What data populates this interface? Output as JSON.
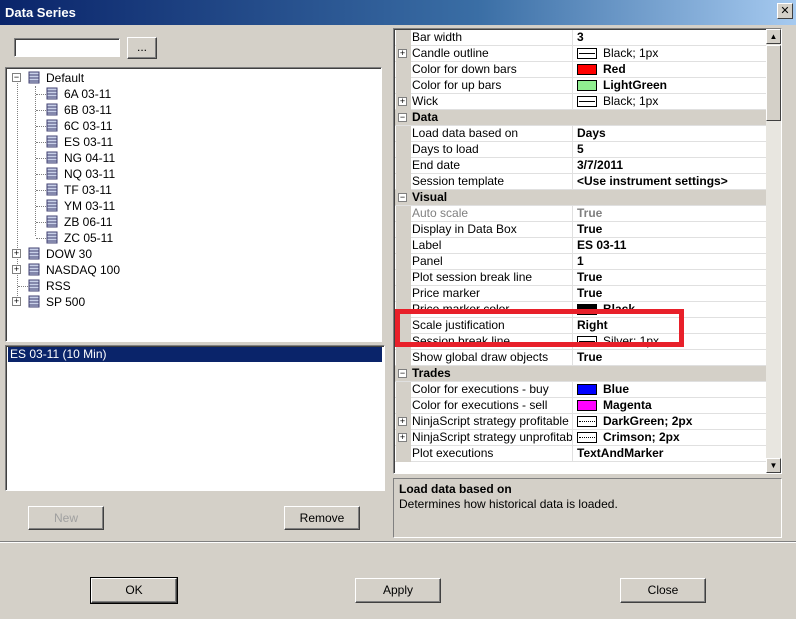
{
  "window": {
    "title": "Data Series",
    "close_glyph": "✕"
  },
  "search": {
    "value": "",
    "button_label": "..."
  },
  "tree": {
    "items": [
      {
        "label": "Default",
        "level": 0,
        "expander": "−"
      },
      {
        "label": "6A 03-11",
        "level": 1
      },
      {
        "label": "6B 03-11",
        "level": 1
      },
      {
        "label": "6C 03-11",
        "level": 1
      },
      {
        "label": "ES 03-11",
        "level": 1
      },
      {
        "label": "NG 04-11",
        "level": 1
      },
      {
        "label": "NQ 03-11",
        "level": 1
      },
      {
        "label": "TF 03-11",
        "level": 1
      },
      {
        "label": "YM 03-11",
        "level": 1
      },
      {
        "label": "ZB 06-11",
        "level": 1
      },
      {
        "label": "ZC 05-11",
        "level": 1
      },
      {
        "label": "DOW 30",
        "level": 0,
        "expander": "+"
      },
      {
        "label": "NASDAQ 100",
        "level": 0,
        "expander": "+"
      },
      {
        "label": "RSS",
        "level": 0
      },
      {
        "label": "SP 500",
        "level": 0,
        "expander": "+"
      }
    ]
  },
  "series_list": {
    "selected": "ES 03-11 (10 Min)"
  },
  "buttons": {
    "new": "New",
    "remove": "Remove",
    "ok": "OK",
    "apply": "Apply",
    "close": "Close"
  },
  "properties": {
    "rows": [
      {
        "name": "Bar width",
        "value": "3"
      },
      {
        "name": "Candle outline",
        "value": "Black; 1px",
        "swatch": "line",
        "expander": "+"
      },
      {
        "name": "Color for down bars",
        "value": "Red",
        "swatch": "#ff0000"
      },
      {
        "name": "Color for up bars",
        "value": "LightGreen",
        "swatch": "#90ee90"
      },
      {
        "name": "Wick",
        "value": "Black; 1px",
        "swatch": "line",
        "expander": "+"
      },
      {
        "name": "Data",
        "category": true
      },
      {
        "name": "Load data based on",
        "value": "Days"
      },
      {
        "name": "Days to load",
        "value": "5"
      },
      {
        "name": "End date",
        "value": "3/7/2011"
      },
      {
        "name": "Session template",
        "value": "<Use instrument settings>"
      },
      {
        "name": "Visual",
        "category": true
      },
      {
        "name": "Auto scale",
        "value": "True",
        "disabled": true
      },
      {
        "name": "Display in Data Box",
        "value": "True"
      },
      {
        "name": "Label",
        "value": "ES 03-11"
      },
      {
        "name": "Panel",
        "value": "1"
      },
      {
        "name": "Plot session break line",
        "value": "True"
      },
      {
        "name": "Price marker",
        "value": "True"
      },
      {
        "name": "Price marker color",
        "value": "Black",
        "swatch": "#000000"
      },
      {
        "name": "Scale justification",
        "value": "Right"
      },
      {
        "name": "Session break line",
        "value": "Silver; 1px",
        "swatch": "line"
      },
      {
        "name": "Show global draw objects",
        "value": "True"
      },
      {
        "name": "Trades",
        "category": true
      },
      {
        "name": "Color for executions - buy",
        "value": "Blue",
        "swatch": "#0000ff"
      },
      {
        "name": "Color for executions - sell",
        "value": "Magenta",
        "swatch": "#ff00ff"
      },
      {
        "name": "NinjaScript strategy profitable trades",
        "value": "DarkGreen; 2px",
        "swatch": "dots",
        "expander": "+"
      },
      {
        "name": "NinjaScript strategy unprofitable trades",
        "value": "Crimson; 2px",
        "swatch": "dots",
        "expander": "+"
      },
      {
        "name": "Plot executions",
        "value": "TextAndMarker"
      }
    ]
  },
  "description": {
    "title": "Load data based on",
    "text": "Determines how historical data is loaded."
  },
  "colors": {
    "highlight": "#e8202a",
    "selection": "#0a246a"
  }
}
